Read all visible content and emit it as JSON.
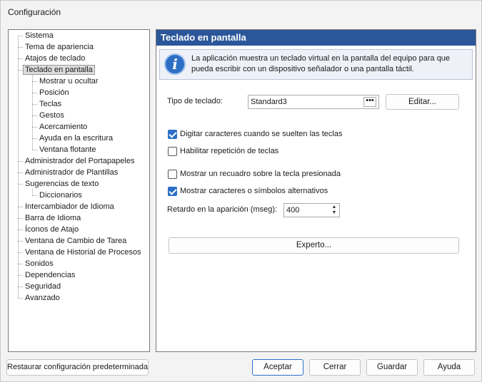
{
  "window": {
    "title": "Configuración"
  },
  "tree": {
    "items": [
      {
        "label": "Sistema",
        "level": 0
      },
      {
        "label": "Tema de apariencia",
        "level": 0
      },
      {
        "label": "Atajos de teclado",
        "level": 0
      },
      {
        "label": "Teclado en pantalla",
        "level": 0,
        "selected": true
      },
      {
        "label": "Mostrar u ocultar",
        "level": 1
      },
      {
        "label": "Posición",
        "level": 1
      },
      {
        "label": "Teclas",
        "level": 1
      },
      {
        "label": "Gestos",
        "level": 1
      },
      {
        "label": "Acercamiento",
        "level": 1
      },
      {
        "label": "Ayuda en la escritura",
        "level": 1
      },
      {
        "label": "Ventana flotante",
        "level": 1
      },
      {
        "label": "Administrador del Portapapeles",
        "level": 0
      },
      {
        "label": "Administrador de Plantillas",
        "level": 0
      },
      {
        "label": "Sugerencias de texto",
        "level": 0
      },
      {
        "label": "Diccionarios",
        "level": 1
      },
      {
        "label": "Intercambiador de Idioma",
        "level": 0
      },
      {
        "label": "Barra de Idioma",
        "level": 0
      },
      {
        "label": "Íconos de Atajo",
        "level": 0
      },
      {
        "label": "Ventana de Cambio de Tarea",
        "level": 0
      },
      {
        "label": "Ventana de Historial de Procesos",
        "level": 0
      },
      {
        "label": "Sonidos",
        "level": 0
      },
      {
        "label": "Dependencias",
        "level": 0
      },
      {
        "label": "Seguridad",
        "level": 0
      },
      {
        "label": "Avanzado",
        "level": 0
      }
    ]
  },
  "panel": {
    "header": "Teclado en pantalla",
    "info_icon": "info-icon",
    "info_text": "La aplicación muestra un teclado virtual en la pantalla del equipo para que pueda escribir con un dispositivo señalador o una pantalla táctil.",
    "keyboard_type_label": "Tipo de teclado:",
    "keyboard_type_value": "Standard3",
    "browse_label": "•••",
    "edit_label": "Editar...",
    "checkboxes": [
      {
        "label": "Digitar caracteres cuando se suelten las teclas",
        "checked": true
      },
      {
        "label": "Habilitar repetición de teclas",
        "checked": false
      },
      {
        "label": "Mostrar un recuadro sobre la tecla presionada",
        "checked": false
      },
      {
        "label": "Mostrar caracteres o símbolos alternativos",
        "checked": true
      }
    ],
    "delay_label": "Retardo en la aparición (mseg):",
    "delay_value": "400",
    "expert_label": "Experto..."
  },
  "footer": {
    "restore_label": "Restaurar configuración predeterminada",
    "accept_label": "Aceptar",
    "cancel_label": "Cerrar",
    "save_label": "Guardar",
    "help_label": "Ayuda"
  },
  "colors": {
    "accent": "#2b579a",
    "check": "#2b6fc7"
  }
}
